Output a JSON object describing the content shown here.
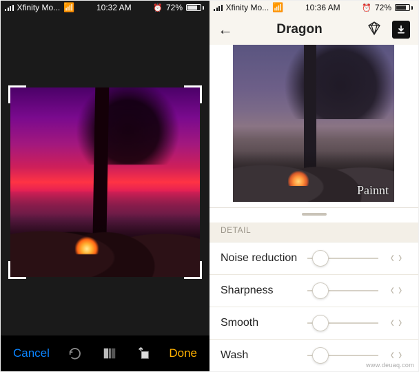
{
  "left": {
    "status": {
      "carrier": "Xfinity Mo...",
      "time": "10:32 AM",
      "battery_pct": "72%"
    },
    "toolbar": {
      "cancel": "Cancel",
      "done": "Done"
    }
  },
  "right": {
    "status": {
      "carrier": "Xfinity Mo...",
      "time": "10:36 AM",
      "battery_pct": "72%"
    },
    "title": "Dragon",
    "watermark": "Painnt",
    "section": "DETAIL",
    "sliders": [
      {
        "label": "Noise reduction",
        "value_pct": 18
      },
      {
        "label": "Sharpness",
        "value_pct": 18
      },
      {
        "label": "Smooth",
        "value_pct": 18
      },
      {
        "label": "Wash",
        "value_pct": 18
      }
    ]
  },
  "site_tag": "www.deuaq.com"
}
